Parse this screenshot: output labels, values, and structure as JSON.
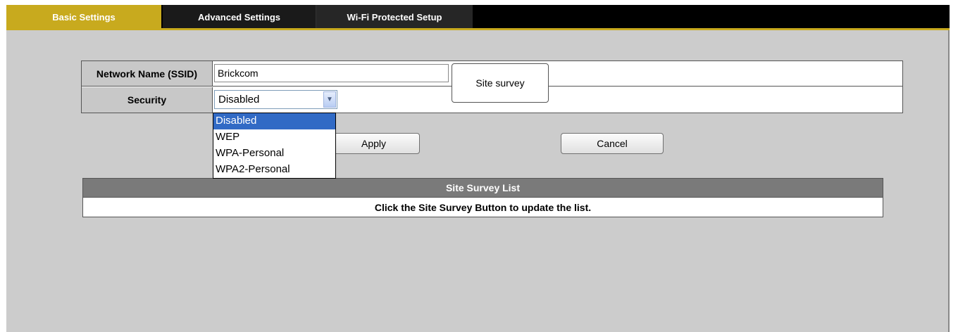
{
  "tabs": [
    {
      "label": "Basic Settings",
      "active": true
    },
    {
      "label": "Advanced Settings",
      "active": false
    },
    {
      "label": "Wi-Fi Protected Setup",
      "active": false
    }
  ],
  "colors": {
    "accent": "#c8aa1e",
    "panel": "#cccccc",
    "header": "#7a7a7a",
    "selection": "#316ac5"
  },
  "form": {
    "ssid_label": "Network Name (SSID)",
    "ssid_value": "Brickcom",
    "site_survey_label": "Site survey",
    "security_label": "Security",
    "security_value": "Disabled",
    "security_options": [
      "Disabled",
      "WEP",
      "WPA-Personal",
      "WPA2-Personal"
    ]
  },
  "actions": {
    "apply_label": "Apply",
    "cancel_label": "Cancel"
  },
  "survey_list": {
    "title": "Site Survey List",
    "message": "Click the Site Survey Button to update the list."
  }
}
